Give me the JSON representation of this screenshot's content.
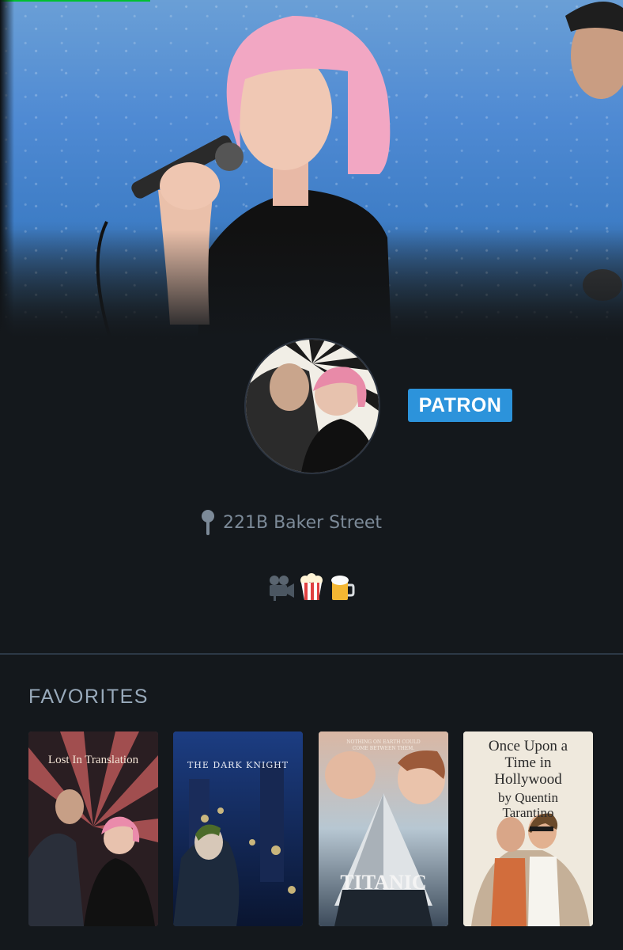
{
  "profile": {
    "badge": "PATRON",
    "location": "221B Baker Street",
    "emojis": [
      "movie-camera",
      "popcorn",
      "beer-mug"
    ]
  },
  "favorites": {
    "title": "FAVORITES",
    "films": [
      {
        "title": "Lost In Translation"
      },
      {
        "title": "THE DARK KNIGHT"
      },
      {
        "title": "TITANIC",
        "tagline": "NOTHING ON EARTH COULD COME BETWEEN THEM."
      },
      {
        "title": "Once Upon a Time in Hollywood",
        "byline": "by Quentin Tarantino"
      }
    ]
  },
  "colors": {
    "background": "#14181c",
    "badge": "#2c93db",
    "accent_bar": "#00c030"
  }
}
